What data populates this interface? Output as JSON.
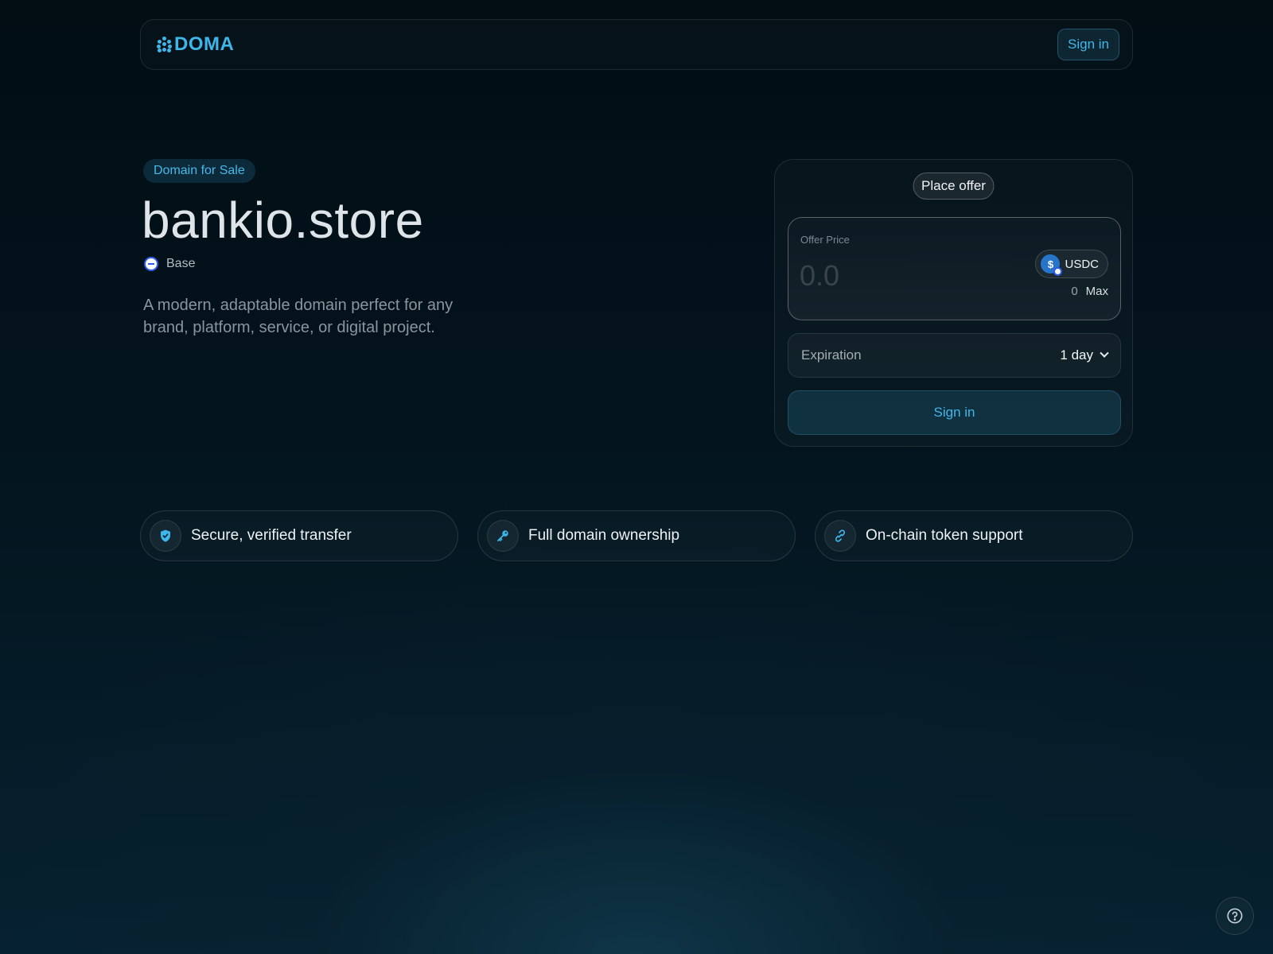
{
  "header": {
    "brand": "DOMA",
    "logo_icon": "doma-dots-icon",
    "signin_label": "Sign in"
  },
  "hero": {
    "badge": "Domain for Sale",
    "domain": "bankio.store",
    "chain": "Base",
    "chain_icon": "base-chain-icon",
    "description": "A modern, adaptable domain perfect for any brand, platform, service, or digital project."
  },
  "offer_card": {
    "title": "Place offer",
    "price_label": "Offer Price",
    "price_placeholder": "0.0",
    "token": "USDC",
    "balance": "0",
    "max_label": "Max",
    "expiration_label": "Expiration",
    "expiration_value": "1 day",
    "signin_label": "Sign in"
  },
  "features": [
    {
      "label": "Secure, verified transfer",
      "icon": "shield-check-icon"
    },
    {
      "label": "Full domain ownership",
      "icon": "key-icon"
    },
    {
      "label": "On-chain token support",
      "icon": "link-icon"
    }
  ],
  "colors": {
    "accent": "#42b6ea",
    "background": "#020d14",
    "base_blue": "#2a5cf0",
    "usdc_blue": "#2775ca"
  },
  "help_icon": "help-circle-icon"
}
